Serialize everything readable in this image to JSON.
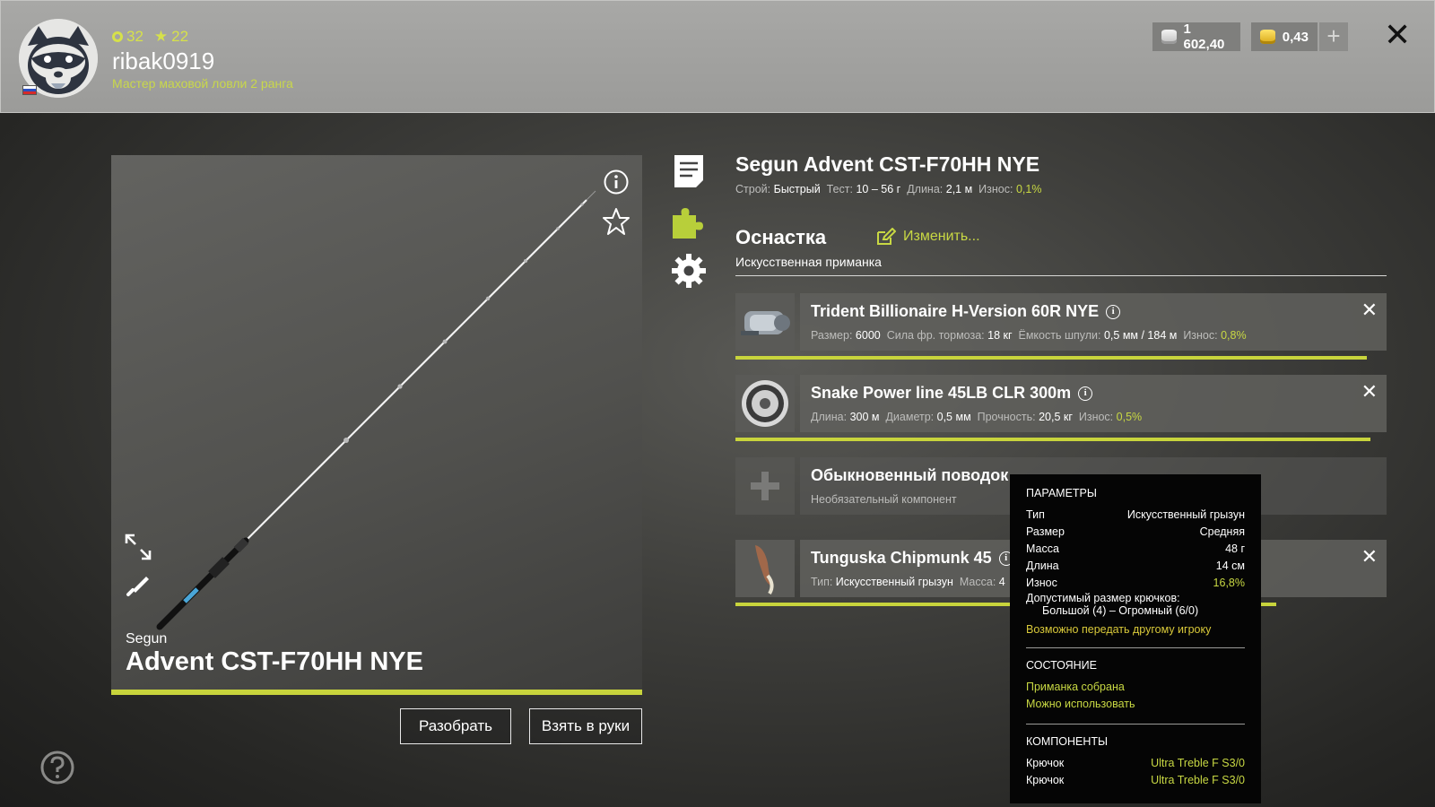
{
  "header": {
    "level": "32",
    "stars": "22",
    "username": "ribak0919",
    "rank": "Мастер маховой ловли 2 ранга",
    "silver": "1 602,40",
    "gold": "0,43"
  },
  "rod": {
    "brand": "Segun",
    "model": "Advent CST-F70HH NYE",
    "full_name": "Segun Advent CST-F70HH NYE",
    "action_label": "Строй:",
    "action": "Быстрый",
    "test_label": "Тест:",
    "test": "10 – 56 г",
    "length_label": "Длина:",
    "length": "2,1 м",
    "wear_label": "Износ:",
    "wear": "0,1%",
    "condition_fraction": 1.0
  },
  "buttons": {
    "disassemble": "Разобрать",
    "equip": "Взять в руки"
  },
  "tackle": {
    "title": "Оснастка",
    "change": "Изменить...",
    "subtitle": "Искусственная приманка"
  },
  "slots": [
    {
      "name": "Trident Billionaire H-Version 60R NYE",
      "stats": [
        {
          "label": "Размер:",
          "value": "6000"
        },
        {
          "label": "Сила фр. тормоза:",
          "value": "18 кг"
        },
        {
          "label": "Ёмкость шпули:",
          "value": "0,5 мм / 184 м"
        },
        {
          "label": "Износ:",
          "value": "0,8%"
        }
      ],
      "condition_fraction": 0.97
    },
    {
      "name": "Snake Power line 45LB CLR 300m",
      "stats": [
        {
          "label": "Длина:",
          "value": "300 м"
        },
        {
          "label": "Диаметр:",
          "value": "0,5 мм"
        },
        {
          "label": "Прочность:",
          "value": "20,5 кг"
        },
        {
          "label": "Износ:",
          "value": "0,5%"
        }
      ],
      "condition_fraction": 0.975
    },
    {
      "name": "Обыкновенный поводок",
      "note": "Необязательный компонент"
    },
    {
      "name": "Tunguska Chipmunk 45",
      "stats": [
        {
          "label": "Тип:",
          "value": "Искусственный грызун"
        },
        {
          "label": "Масса:",
          "value": "4"
        }
      ],
      "condition_fraction": 0.83
    }
  ],
  "tooltip": {
    "params_header": "ПАРАМЕТРЫ",
    "params": [
      {
        "label": "Тип",
        "value": "Искусственный грызун"
      },
      {
        "label": "Размер",
        "value": "Средняя"
      },
      {
        "label": "Масса",
        "value": "48 г"
      },
      {
        "label": "Длина",
        "value": "14 см"
      },
      {
        "label": "Износ",
        "value": "16,8%"
      }
    ],
    "hook_size_label": "Допустимый размер крючков:",
    "hook_size_value": "Большой (4) – Огромный (6/0)",
    "transfer_note": "Возможно передать другому игроку",
    "state_header": "СОСТОЯНИЕ",
    "state_lines": [
      "Приманка собрана",
      "Можно использовать"
    ],
    "components_header": "КОМПОНЕНТЫ",
    "components": [
      {
        "label": "Крючок",
        "value": "Ultra Treble F S3/0"
      },
      {
        "label": "Крючок",
        "value": "Ultra Treble F S3/0"
      }
    ]
  },
  "colors": {
    "accent": "#c8d43c",
    "header_bg": "#a2a2a0"
  },
  "icons": [
    "avatar-raccoon",
    "ru-flag-icon",
    "ring-icon",
    "star-icon",
    "silver-coin-icon",
    "gold-coin-icon",
    "plus-icon",
    "close-icon",
    "info-icon",
    "star-outline-icon",
    "expand-icon",
    "brush-icon",
    "help-icon",
    "document-icon",
    "puzzle-icon",
    "gear-icon",
    "edit-icon",
    "remove-icon"
  ]
}
